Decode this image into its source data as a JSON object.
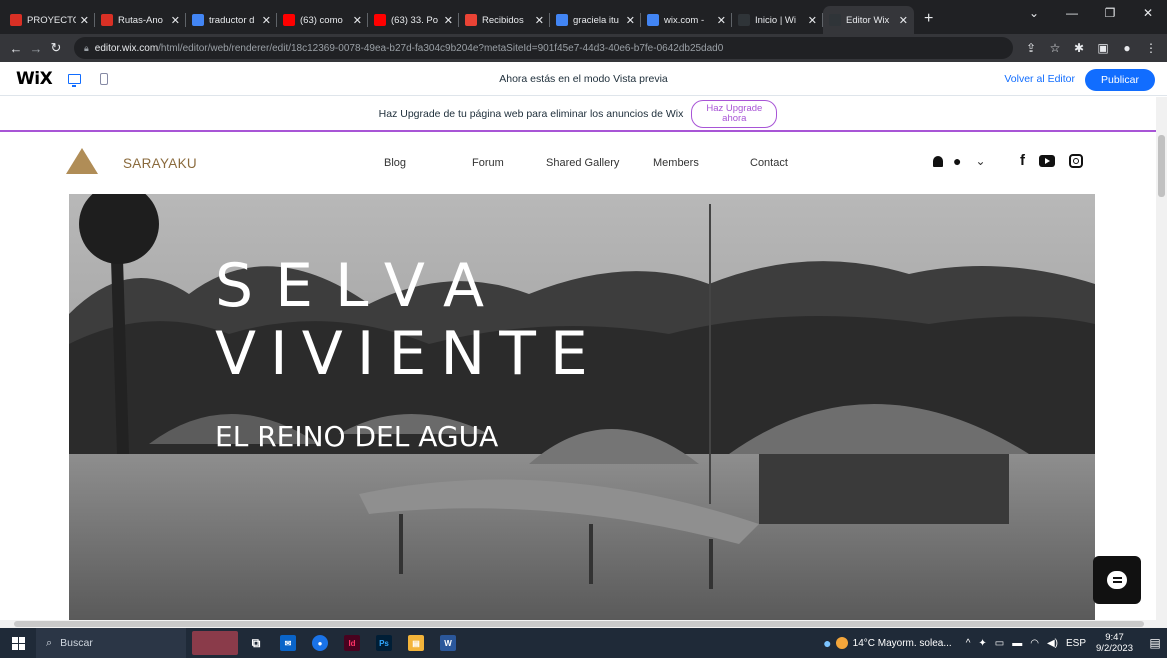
{
  "browser": {
    "tabs": [
      {
        "title": "PROYECTO",
        "fav_color": "#d93025"
      },
      {
        "title": "Rutas-Ano",
        "fav_color": "#d93025"
      },
      {
        "title": "traductor d",
        "fav_color": "#4285f4"
      },
      {
        "title": "(63) como",
        "fav_color": "#ff0000"
      },
      {
        "title": "(63) 33. Po",
        "fav_color": "#ff0000"
      },
      {
        "title": "Recibidos",
        "fav_color": "#ea4335"
      },
      {
        "title": "graciela itu",
        "fav_color": "#4285f4"
      },
      {
        "title": "wix.com -",
        "fav_color": "#4285f4"
      },
      {
        "title": "Inicio | Wi",
        "fav_color": "#2f3438"
      },
      {
        "title": "Editor Wix",
        "fav_color": "#2f3438"
      }
    ],
    "active_tab": 9,
    "url_host": "editor.wix.com",
    "url_path": "/html/editor/web/renderer/edit/18c12369-0078-49ea-b27d-fa304c9b204e?metaSiteId=901f45e7-44d3-40e6-b7fe-0642db25dad0"
  },
  "wix_bar": {
    "logo": "WiX",
    "preview_text": "Ahora estás en el modo Vista previa",
    "back_label": "Volver al Editor",
    "publish_label": "Publicar"
  },
  "upgrade": {
    "text": "Haz Upgrade de tu página web para eliminar los anuncios de Wix",
    "button_line1": "Haz Upgrade",
    "button_line2": "ahora"
  },
  "site": {
    "brand": "SARAYAKU",
    "nav": [
      "Blog",
      "Forum",
      "Shared Gallery",
      "Members",
      "Contact"
    ],
    "hero_line1": "SELVA",
    "hero_line2": "VIVIENTE",
    "hero_subtitle": "EL REINO DEL AGUA"
  },
  "taskbar": {
    "search_placeholder": "Buscar",
    "weather": "14°C  Mayorm. solea...",
    "language": "ESP",
    "time": "9:47",
    "date": "9/2/2023"
  }
}
